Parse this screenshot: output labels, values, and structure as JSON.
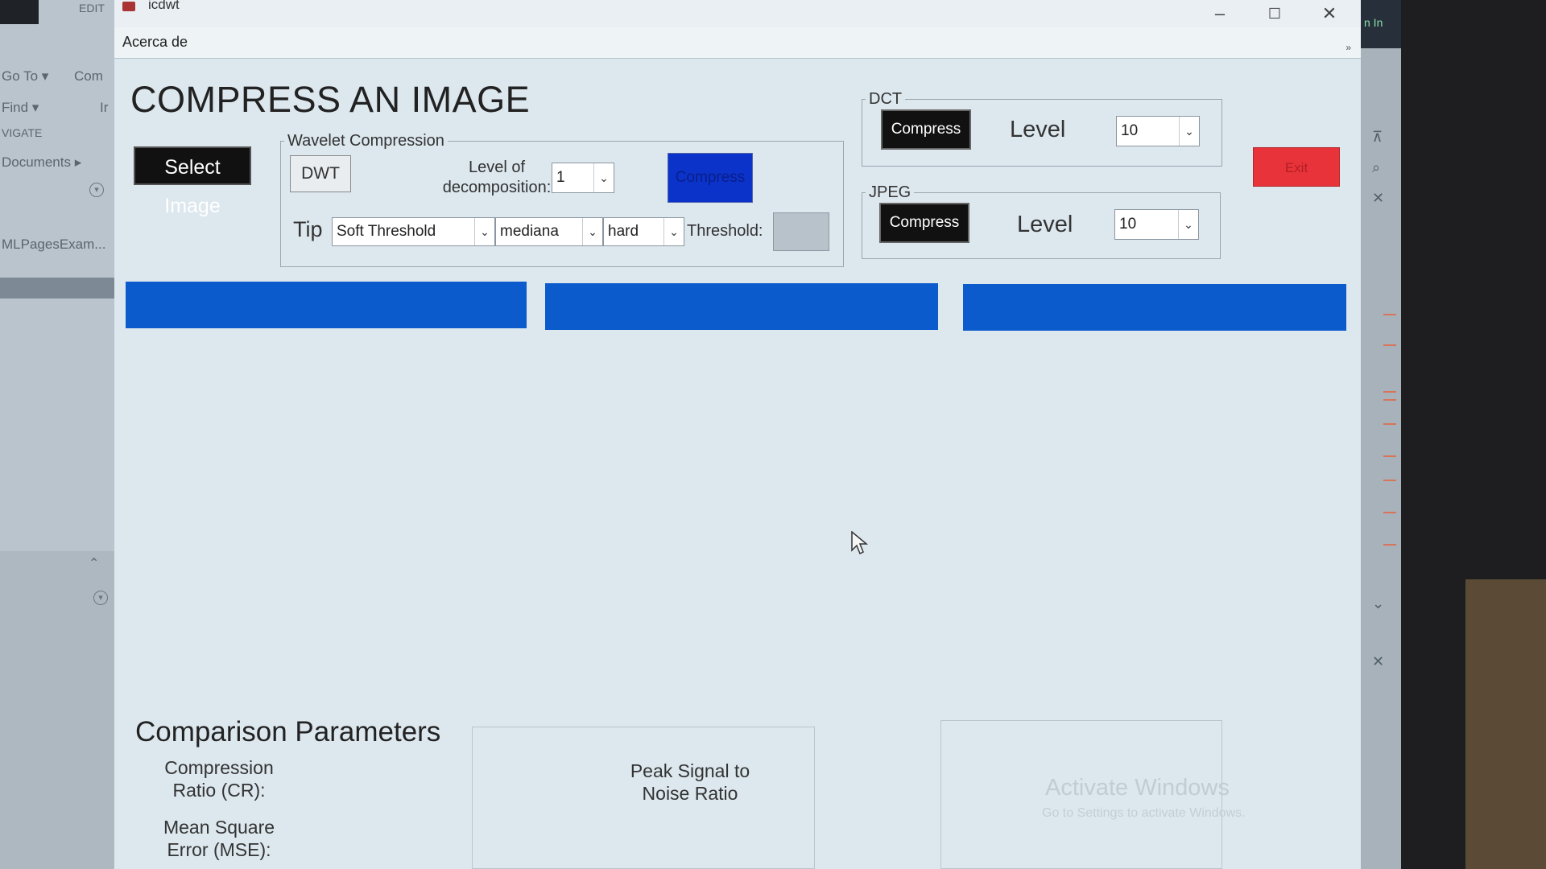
{
  "background_ide": {
    "left_items": [
      "EDIT",
      "Go To ▾",
      "Com",
      "Find ▾",
      "Ir",
      "VIGATE",
      "Documents ▸",
      "MLPagesExam..."
    ],
    "right_top_text": "n In"
  },
  "window": {
    "title": "icdwt",
    "menu": [
      "Acerca de"
    ]
  },
  "app": {
    "title": "COMPRESS AN IMAGE",
    "select_image_label": "Select Image",
    "exit_label": "Exit"
  },
  "wavelet": {
    "legend": "Wavelet Compression",
    "dwt_label": "DWT",
    "level_label_line1": "Level of",
    "level_label_line2": "decomposition:",
    "level_value": "1",
    "compress_label": "Compress",
    "tip_label": "Tip",
    "threshold_type": "Soft Threshold",
    "estimator": "mediana",
    "mode": "hard",
    "threshold_label": "Threshold:",
    "threshold_value": ""
  },
  "dct": {
    "legend": "DCT",
    "compress_label": "Compress",
    "level_label": "Level",
    "level_value": "10"
  },
  "jpeg": {
    "legend": "JPEG",
    "compress_label": "Compress",
    "level_label": "Level",
    "level_value": "10"
  },
  "comparison": {
    "title": "Comparison Parameters",
    "cr_line1": "Compression",
    "cr_line2": "Ratio (CR):",
    "mse_line1": "Mean Square",
    "mse_line2": "Error (MSE):",
    "psnr_line1": "Peak Signal to",
    "psnr_line2": "Noise Ratio"
  },
  "watermark": {
    "line1": "Activate Windows",
    "line2": "Go to Settings to activate Windows."
  },
  "colors": {
    "panel_blue": "#0c5bcc",
    "exit_red": "#e8333a",
    "wavelet_compress_blue": "#0b33c9"
  }
}
